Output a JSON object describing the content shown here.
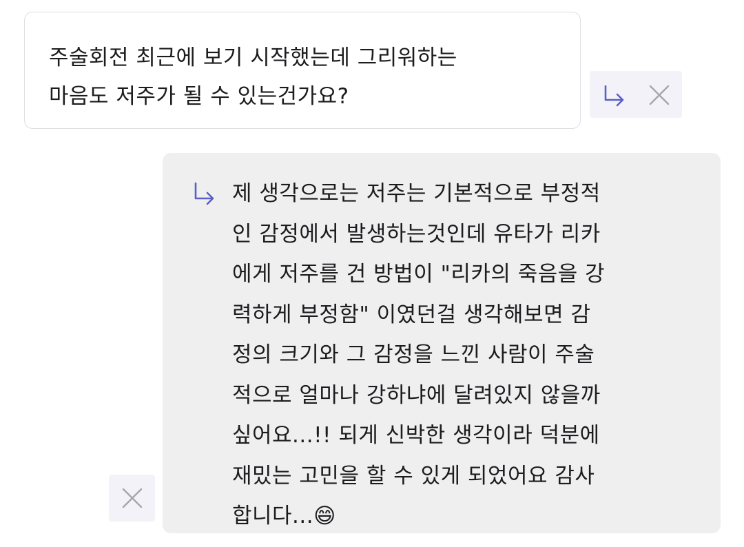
{
  "question": {
    "text": "주술회전 최근에 보기 시작했는데 그리워하는\n마음도 저주가 될 수 있는건가요?"
  },
  "answer": {
    "text": "제 생각으로는 저주는 기본적으로 부정적\n인 감정에서 발생하는것인데 유타가 리카\n에게 저주를 건 방법이 \"리카의 죽음을 강\n력하게 부정함\" 이였던걸 생각해보면 감\n정의 크기와 그 감정을 느낀 사람이 주술\n적으로 얼마나 강하냐에 달려있지 않을까\n싶어요...!! 되게 신박한 생각이라 덕분에\n재밌는 고민을 할 수 있게 되었어요 감사\n합니다...😄"
  },
  "colors": {
    "accent": "#5b5fc7",
    "icon_gray": "#a5a5ad",
    "action_bg": "#f2f2f8",
    "answer_bg": "#efeff0"
  },
  "icons": {
    "reply": "reply-arrow-icon",
    "close": "close-icon"
  }
}
